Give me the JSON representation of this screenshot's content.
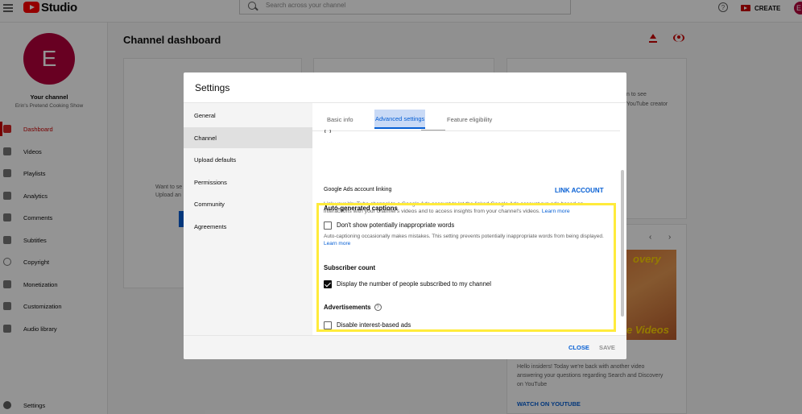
{
  "app": {
    "logo_text": "Studio"
  },
  "search": {
    "placeholder": "Search across your channel"
  },
  "header": {
    "help_glyph": "?",
    "create_label": "CREATE",
    "avatar_letter": "E"
  },
  "channel": {
    "avatar_letter": "E",
    "label": "Your channel",
    "name": "Erin's Pretend Cooking Show"
  },
  "sidebar": {
    "items": [
      {
        "label": "Dashboard",
        "icon": "grid-icon",
        "active": true
      },
      {
        "label": "Videos",
        "icon": "video-icon"
      },
      {
        "label": "Playlists",
        "icon": "playlist-icon"
      },
      {
        "label": "Analytics",
        "icon": "analytics-icon"
      },
      {
        "label": "Comments",
        "icon": "comments-icon"
      },
      {
        "label": "Subtitles",
        "icon": "subtitles-icon"
      },
      {
        "label": "Copyright",
        "icon": "copyright-icon"
      },
      {
        "label": "Monetization",
        "icon": "dollar-icon"
      },
      {
        "label": "Customization",
        "icon": "wand-icon"
      },
      {
        "label": "Audio library",
        "icon": "audio-library-icon"
      }
    ],
    "settings_label": "Settings"
  },
  "main": {
    "title": "Channel dashboard",
    "bg_left_text_1": "Want to se",
    "bg_left_text_2": "Upload an",
    "bg_right_text_1": "n to see",
    "bg_right_text_2": "YouTube creator",
    "thumb_text_top": "overy",
    "thumb_text_bottom": "be Videos",
    "footer_text_1": "Hello insiders! Today we're back with another video",
    "footer_text_2": "answering your questions regarding Search and Discovery",
    "footer_text_3": "on YouTube",
    "watch_link": "WATCH ON YOUTUBE"
  },
  "dialog": {
    "title": "Settings",
    "nav": [
      {
        "label": "General"
      },
      {
        "label": "Channel",
        "active": true
      },
      {
        "label": "Upload defaults"
      },
      {
        "label": "Permissions"
      },
      {
        "label": "Community"
      },
      {
        "label": "Agreements"
      }
    ],
    "tabs": [
      {
        "label": "Basic info"
      },
      {
        "label": "Advanced settings",
        "active": true
      },
      {
        "label": "Feature eligibility"
      }
    ],
    "ads_linking": {
      "label": "Google Ads account linking",
      "button": "LINK ACCOUNT",
      "description": "Link your YouTube channel to a Google Ads account to let the linked Google Ads account run ads based on interactions with your channel's videos and to access insights from your channel's videos.",
      "learn_more": "Learn more"
    },
    "captions": {
      "title": "Auto-generated captions",
      "checkbox_label": "Don't show potentially inappropriate words",
      "checked": false,
      "description": "Auto-captioning occasionally makes mistakes. This setting prevents potentially inappropriate words from being displayed.",
      "learn_more": "Learn more"
    },
    "subscriber_count": {
      "title": "Subscriber count",
      "checkbox_label": "Display the number of people subscribed to my channel",
      "checked": true
    },
    "advertisements": {
      "title": "Advertisements",
      "help_glyph": "?",
      "checkbox_label": "Disable interest-based ads",
      "checked": false
    },
    "footer": {
      "close": "CLOSE",
      "save": "SAVE"
    }
  },
  "colors": {
    "brand_red": "#ff0000",
    "link_blue": "#065fd4",
    "highlight": "#ffeb3b",
    "avatar": "#b3003b"
  }
}
